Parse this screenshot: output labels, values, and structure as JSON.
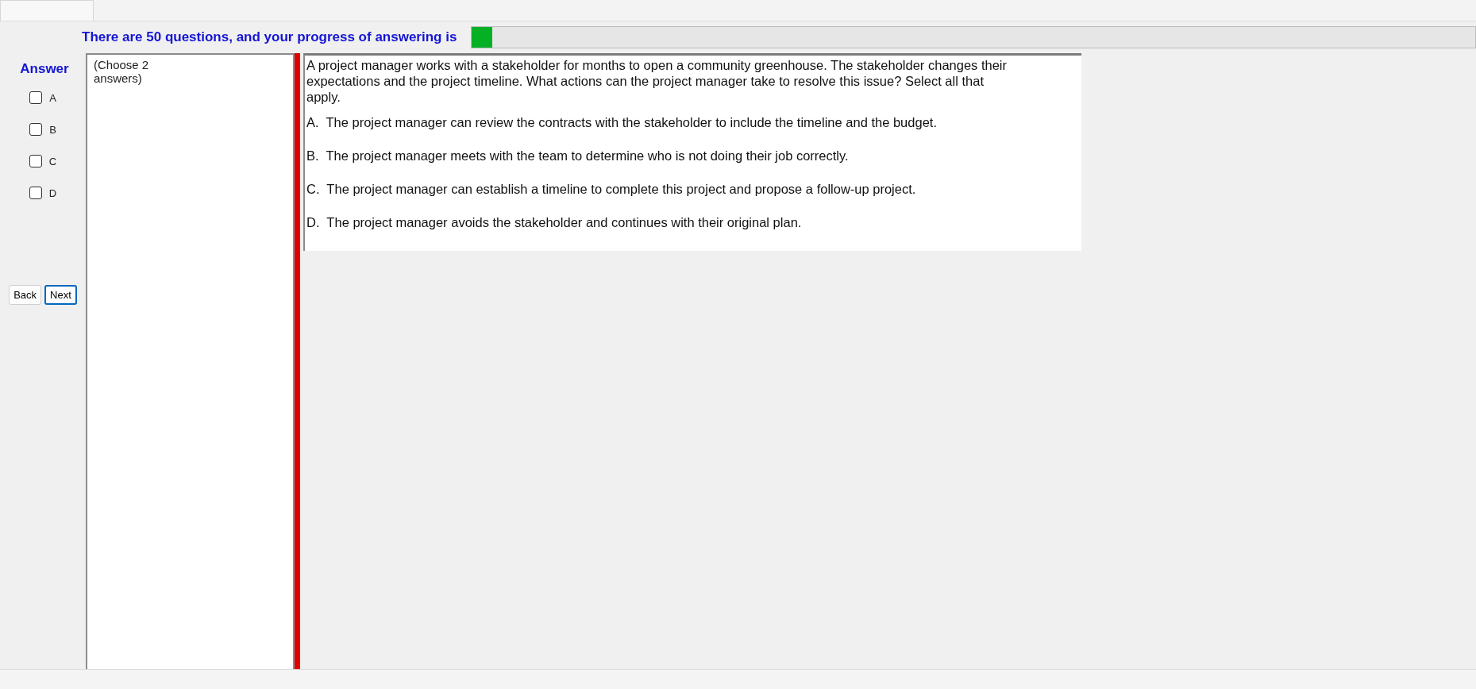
{
  "header": {
    "text": "There are 50 questions, and your progress of answering is",
    "progress": {
      "level": 0.02
    }
  },
  "answer": {
    "label": "Answer",
    "options": [
      {
        "label": "A",
        "checked": false
      },
      {
        "label": "B",
        "checked": false
      },
      {
        "label": "C",
        "checked": false
      },
      {
        "label": "D",
        "checked": false
      }
    ]
  },
  "buttons": [
    {
      "label": "Back",
      "focused": false
    },
    {
      "label": "Next",
      "focused": true
    }
  ],
  "instruction": "(Choose 2 answers)",
  "question": {
    "text": "A project manager works with a stakeholder for months to open a community greenhouse. The stakeholder changes their expectations and the project timeline. What actions can the project manager take to resolve this issue? Select all that apply.",
    "choices": [
      {
        "letter": "A.",
        "text": "The project manager can review the contracts with the stakeholder to include the timeline and the budget."
      },
      {
        "letter": "B.",
        "text": "The project manager meets with the team to determine who is not doing their job correctly."
      },
      {
        "letter": "C.",
        "text": "The project manager can establish a timeline to complete this project and propose a follow-up project."
      },
      {
        "letter": "D.",
        "text": "The project manager avoids the stakeholder and continues with their original plan."
      }
    ]
  }
}
